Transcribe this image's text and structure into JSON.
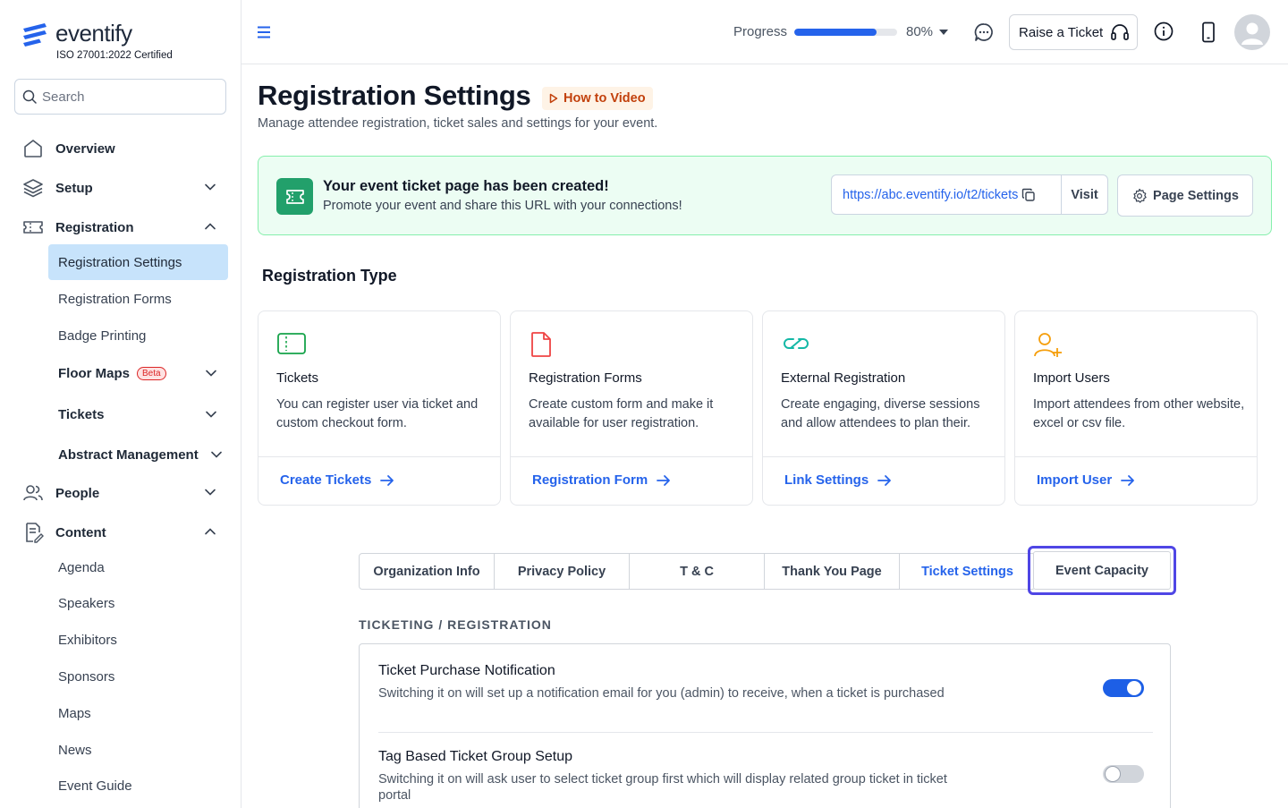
{
  "brand": {
    "name": "eventify",
    "certification": "ISO 27001:2022 Certified"
  },
  "search": {
    "placeholder": "Search"
  },
  "sidebar": {
    "overview": "Overview",
    "setup": "Setup",
    "registration": "Registration",
    "registration_items": [
      {
        "label": "Registration Settings"
      },
      {
        "label": "Registration Forms"
      },
      {
        "label": "Badge Printing"
      },
      {
        "label": "Floor Maps",
        "badge": "Beta"
      },
      {
        "label": "Tickets"
      },
      {
        "label": "Abstract Management"
      }
    ],
    "people": "People",
    "content": "Content",
    "content_items": [
      {
        "label": "Agenda"
      },
      {
        "label": "Speakers"
      },
      {
        "label": "Exhibitors"
      },
      {
        "label": "Sponsors"
      },
      {
        "label": "Maps"
      },
      {
        "label": "News"
      },
      {
        "label": "Event Guide"
      }
    ]
  },
  "header": {
    "progress_label": "Progress",
    "progress_value": "80%",
    "progress_fraction": 0.8,
    "raise_ticket": "Raise a Ticket"
  },
  "page": {
    "title": "Registration Settings",
    "video_link": "How to Video",
    "subtitle": "Manage attendee registration, ticket sales and settings for your event."
  },
  "banner": {
    "title": "Your event ticket page has been created!",
    "subtitle": "Promote your event and share this URL with your connections!",
    "url": "https://abc.eventify.io/t2/tickets",
    "visit": "Visit",
    "page_settings": "Page Settings"
  },
  "registration_type": {
    "title": "Registration Type",
    "cards": [
      {
        "title": "Tickets",
        "desc": "You can register user via ticket and custom checkout form.",
        "link": "Create Tickets",
        "icon": "ticket-icon"
      },
      {
        "title": "Registration Forms",
        "desc": "Create custom form and make it available for user registration.",
        "link": "Registration Form",
        "icon": "document-icon"
      },
      {
        "title": "External Registration",
        "desc": "Create engaging, diverse sessions and allow attendees to plan their.",
        "link": "Link Settings",
        "icon": "link-icon"
      },
      {
        "title": "Import Users",
        "desc": "Import attendees from other website, excel or csv file.",
        "link": "Import User",
        "icon": "user-add-icon"
      }
    ]
  },
  "tabs": [
    "Organization Info",
    "Privacy Policy",
    "T & C",
    "Thank You Page",
    "Ticket Settings",
    "Event Capacity"
  ],
  "ticketing": {
    "title": "TICKETING / REGISTRATION",
    "settings": [
      {
        "title": "Ticket Purchase Notification",
        "desc": "Switching it on will set up a notification email for you (admin) to receive, when a ticket is purchased",
        "enabled": true
      },
      {
        "title": "Tag Based Ticket Group Setup",
        "desc": "Switching it on will ask user to select ticket group first which will display related group ticket in ticket portal",
        "enabled": false
      }
    ]
  },
  "colors": {
    "accent": "#2563eb",
    "banner_bg": "#ecfdf3",
    "focus_ring": "#4f46e5"
  }
}
